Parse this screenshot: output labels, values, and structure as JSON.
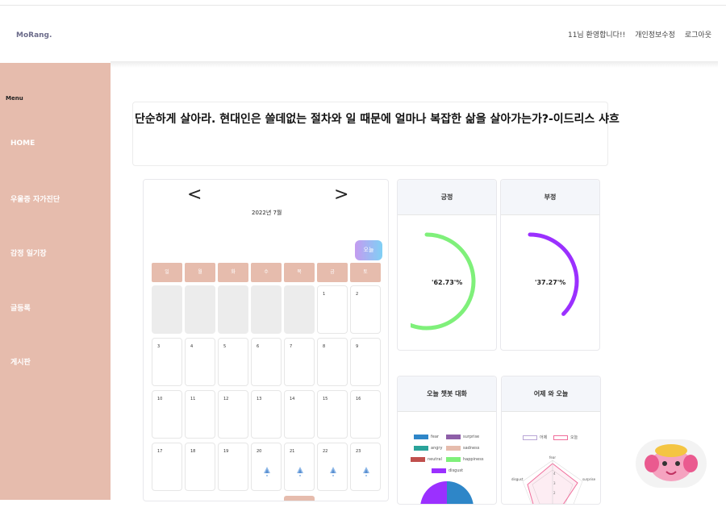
{
  "header": {
    "logo": "MoRang.",
    "nav": [
      "11님 환영합니다!!",
      "개인정보수정",
      "로그아웃"
    ]
  },
  "sidebar": {
    "title": "Menu",
    "items": [
      "HOME",
      "우울증 자가진단",
      "감정 일기장",
      "글등록",
      "게시판"
    ]
  },
  "quote": "단순하게 살아라. 현대인은 쓸데없는 절차와 일 때문에 얼마나 복잡한 삶을 살아가는가?-이드리스 샤흐",
  "calendar": {
    "title": "2022년 7월",
    "prev": "<",
    "next": ">",
    "today_label": "오늘",
    "weekdays": [
      "일",
      "월",
      "화",
      "수",
      "목",
      "금",
      "토"
    ],
    "week1": [
      "",
      "",
      "",
      "",
      "",
      "1",
      "2"
    ],
    "week2": [
      "3",
      "4",
      "5",
      "6",
      "7",
      "8",
      "9"
    ],
    "week3": [
      "10",
      "11",
      "12",
      "13",
      "14",
      "15",
      "16"
    ],
    "week4": [
      "17",
      "18",
      "19",
      "20",
      "21",
      "22",
      "23"
    ]
  },
  "mood": {
    "positive_label": "긍정",
    "positive_value": "'62.73'%",
    "positive_fraction": 0.6273,
    "negative_label": "부정",
    "negative_value": "'37.27'%",
    "negative_fraction": 0.3727,
    "positive_color": "#7ff07a",
    "negative_color": "#9b30ff"
  },
  "chat": {
    "title": "오늘 챗봇 대화",
    "legend": [
      {
        "label": "fear",
        "color": "#2e86c8"
      },
      {
        "label": "surprise",
        "color": "#8e5fa8"
      },
      {
        "label": "angry",
        "color": "#2aa39a"
      },
      {
        "label": "sadness",
        "color": "#e6bcad"
      },
      {
        "label": "neutral",
        "color": "#c0504d"
      },
      {
        "label": "happiness",
        "color": "#7ff07a"
      },
      {
        "label": "disgust",
        "color": "#9b30ff"
      }
    ]
  },
  "compare": {
    "title": "어제 와 오늘",
    "legend": [
      "어제",
      "오늘"
    ],
    "axes": [
      "fear",
      "surprise",
      "disgust"
    ],
    "ticks": [
      "4",
      "3",
      "2"
    ]
  }
}
